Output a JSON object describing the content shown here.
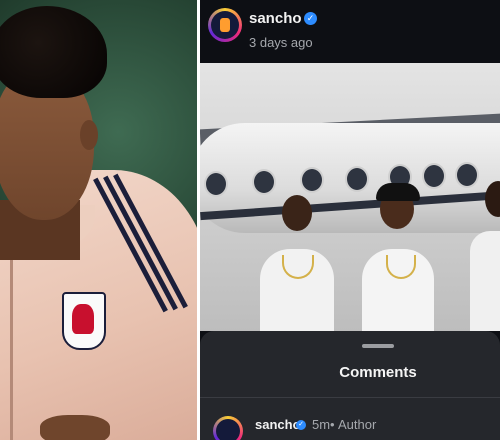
{
  "post": {
    "username": "sancho",
    "verified_glyph": "✓",
    "timestamp": "3 days ago",
    "avatar_icon": "profile-avatar-icon"
  },
  "comments_sheet": {
    "title": "Comments",
    "comment": {
      "username": "sancho",
      "verified_glyph": "✓",
      "time": "5m",
      "separator": "•",
      "role": "Author"
    }
  },
  "colors": {
    "verified_blue": "#2d8cff",
    "sheet_background": "#25272c",
    "header_background": "#0d0f14"
  }
}
